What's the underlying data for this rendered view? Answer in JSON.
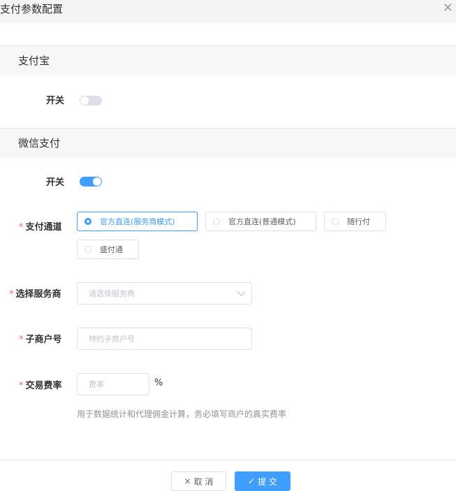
{
  "dialog": {
    "title": "支付参数配置",
    "close_icon": "close-icon"
  },
  "alipay": {
    "section_title": "支付宝",
    "switch_label": "开关",
    "switch_on": false
  },
  "wechat": {
    "section_title": "微信支付",
    "switch_label": "开关",
    "switch_on": true,
    "channel": {
      "label": "支付通道",
      "options": [
        "官方直连(服务商模式)",
        "官方直连(普通模式)",
        "随行付",
        "盛付通"
      ],
      "selected": "官方直连(服务商模式)"
    },
    "provider": {
      "label": "选择服务商",
      "placeholder": "请选择服务商"
    },
    "sub_merchant": {
      "label": "子商户号",
      "placeholder": "特约子商户号"
    },
    "fee_rate": {
      "label": "交易费率",
      "placeholder": "费率",
      "unit": "%",
      "hint": "用于数据统计和代理佣金计算，务必填写商户的真实费率"
    }
  },
  "footer": {
    "cancel_label": "取 消",
    "cancel_icon": "×",
    "submit_label": "提 交",
    "submit_icon": "✓"
  },
  "colors": {
    "primary": "#409eff",
    "required": "#f56c6c",
    "border": "#dcdfe6"
  }
}
